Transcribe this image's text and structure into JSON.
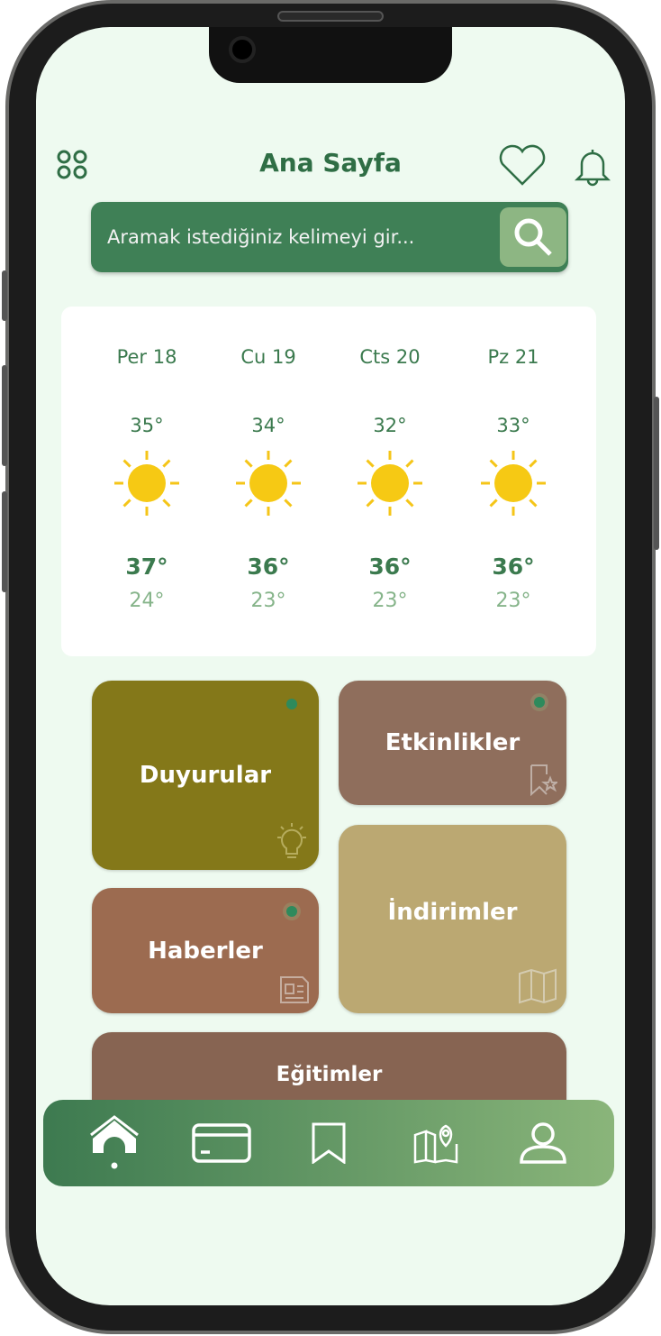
{
  "header": {
    "title": "Ana Sayfa",
    "left_icon": "grid-icon",
    "right_icons": [
      "heart-icon",
      "bell-icon"
    ]
  },
  "search": {
    "placeholder": "Aramak istediğiniz kelimeyi gir...",
    "icon": "search-icon"
  },
  "weather": [
    {
      "day": "Per 18",
      "current": "35°",
      "high": "37°",
      "low": "24°",
      "icon": "sun-icon"
    },
    {
      "day": "Cu 19",
      "current": "34°",
      "high": "36°",
      "low": "23°",
      "icon": "sun-icon"
    },
    {
      "day": "Cts 20",
      "current": "32°",
      "high": "36°",
      "low": "23°",
      "icon": "sun-icon"
    },
    {
      "day": "Pz 21",
      "current": "33°",
      "high": "36°",
      "low": "23°",
      "icon": "sun-icon"
    }
  ],
  "tiles": [
    {
      "label": "Duyurular",
      "color": "#847819",
      "icon": "lightbulb-icon"
    },
    {
      "label": "Etkinlikler",
      "color": "#8f6e5c",
      "icon": "bookmark-star-icon"
    },
    {
      "label": "Haberler",
      "color": "#9c6b50",
      "icon": "newspaper-icon"
    },
    {
      "label": "İndirimler",
      "color": "#bba872",
      "icon": "map-icon"
    },
    {
      "label": "Eğitimler",
      "color": "#876452"
    }
  ],
  "nav": {
    "items": [
      "home-icon",
      "card-icon",
      "bookmark-icon",
      "map-pin-icon",
      "user-icon"
    ],
    "active": "home-icon"
  },
  "colors": {
    "primary": "#3f8056",
    "background": "#eefaf0",
    "text": "#2f6e45"
  }
}
